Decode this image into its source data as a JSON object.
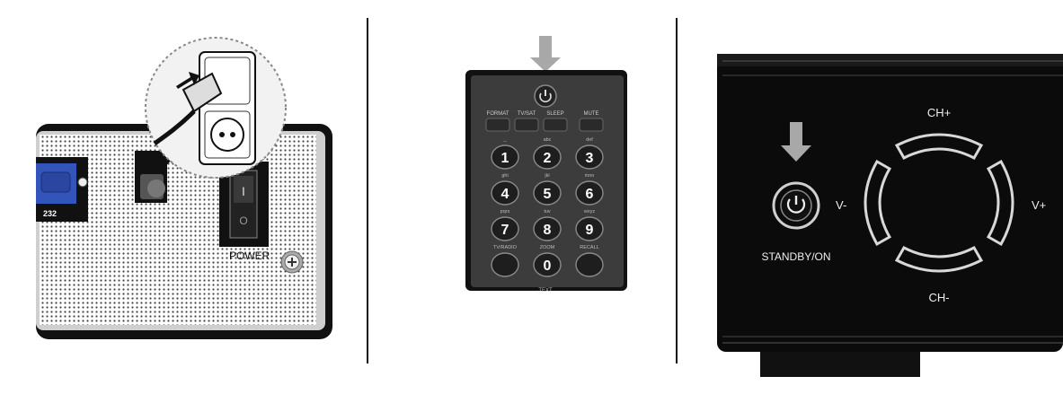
{
  "rear_panel": {
    "rs232_label": "232",
    "power_label": "POWER",
    "switch_on": "I",
    "switch_off": "O"
  },
  "remote": {
    "top_labels": [
      "FORMAT",
      "TV/SAT",
      "SLEEP",
      "MUTE"
    ],
    "keys": [
      {
        "num": "1",
        "sub": "_"
      },
      {
        "num": "2",
        "sub": "abc"
      },
      {
        "num": "3",
        "sub": "def"
      },
      {
        "num": "4",
        "sub": "ghi"
      },
      {
        "num": "5",
        "sub": "jkl"
      },
      {
        "num": "6",
        "sub": "mno"
      },
      {
        "num": "7",
        "sub": "pqrs"
      },
      {
        "num": "8",
        "sub": "tuv"
      },
      {
        "num": "9",
        "sub": "wxyz"
      },
      {
        "num": "",
        "sub": "TV/RADIO"
      },
      {
        "num": "0",
        "sub": "ZOOM"
      },
      {
        "num": "",
        "sub": "RECALL"
      }
    ],
    "bottom_label": "TEXT"
  },
  "front_panel": {
    "ch_up": "CH+",
    "ch_down": "CH-",
    "vol_down": "V-",
    "vol_up": "V+",
    "standby_label": "STANDBY/ON"
  },
  "colors": {
    "arrow": "#a8a8a8",
    "device_black": "#0b0b0b",
    "remote_body": "#3c3c3c",
    "rs232_port": "#3355bb"
  }
}
